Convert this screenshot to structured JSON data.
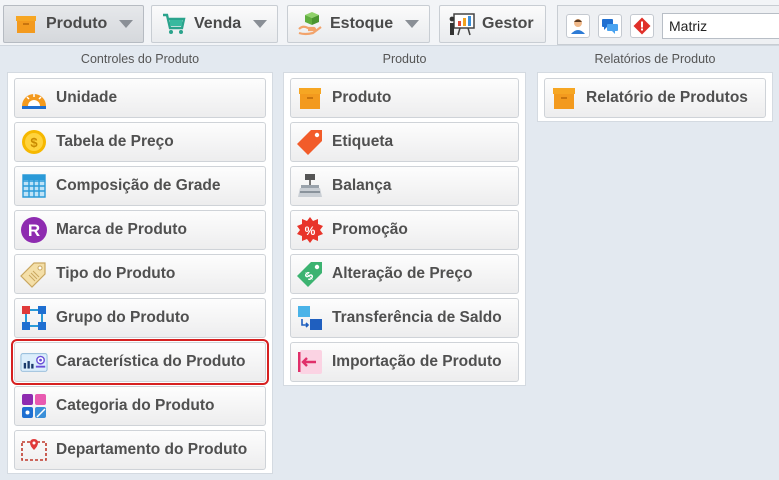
{
  "topbar": {
    "menus": [
      {
        "label": "Produto",
        "icon": "box-icon",
        "has_caret": true,
        "active": true
      },
      {
        "label": "Venda",
        "icon": "cart-icon",
        "has_caret": true,
        "active": false
      },
      {
        "label": "Estoque",
        "icon": "stock-icon",
        "has_caret": true,
        "active": false
      },
      {
        "label": "Gestor",
        "icon": "board-icon",
        "has_caret": false,
        "active": false
      }
    ],
    "tools": [
      "user-icon",
      "chat-icon",
      "alert-icon"
    ],
    "branch_value": "Matriz"
  },
  "columns": [
    {
      "title": "Controles do Produto",
      "items": [
        {
          "label": "Unidade",
          "icon": "ruler-icon"
        },
        {
          "label": "Tabela de Preço",
          "icon": "coin-icon"
        },
        {
          "label": "Composição de Grade",
          "icon": "grid-icon"
        },
        {
          "label": "Marca de Produto",
          "icon": "brand-icon"
        },
        {
          "label": "Tipo do Produto",
          "icon": "tag-icon"
        },
        {
          "label": "Grupo do Produto",
          "icon": "group-icon"
        },
        {
          "label": "Característica do Produto",
          "icon": "feature-icon",
          "selected": true
        },
        {
          "label": "Categoria do Produto",
          "icon": "category-icon"
        },
        {
          "label": "Departamento do Produto",
          "icon": "department-icon"
        }
      ]
    },
    {
      "title": "Produto",
      "items": [
        {
          "label": "Produto",
          "icon": "box-icon"
        },
        {
          "label": "Etiqueta",
          "icon": "label-icon"
        },
        {
          "label": "Balança",
          "icon": "scale-icon"
        },
        {
          "label": "Promoção",
          "icon": "percent-icon"
        },
        {
          "label": "Alteração de Preço",
          "icon": "price-change-icon"
        },
        {
          "label": "Transferência de Saldo",
          "icon": "transfer-icon"
        },
        {
          "label": "Importação de Produto",
          "icon": "import-icon"
        }
      ]
    },
    {
      "title": "Relatórios de Produto",
      "items": [
        {
          "label": "Relatório de Produtos",
          "icon": "box-icon"
        }
      ]
    }
  ],
  "colors": {
    "selected_outline": "#d62020",
    "accent_orange": "#f39a1e"
  }
}
